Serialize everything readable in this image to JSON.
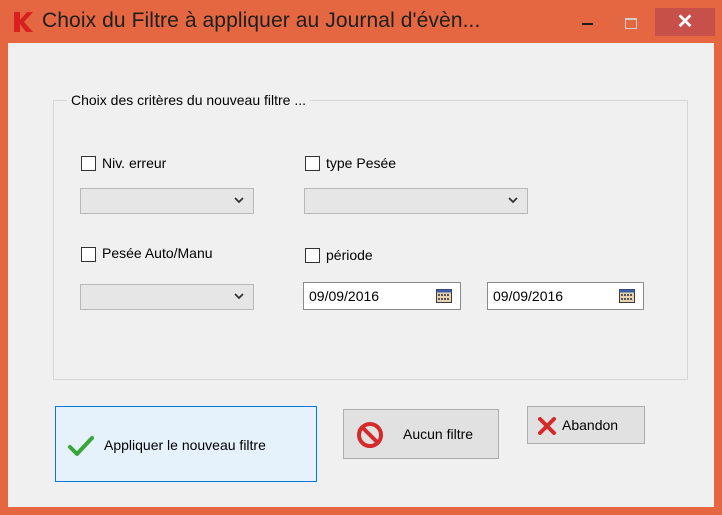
{
  "window": {
    "title": "Choix du Filtre à appliquer au Journal d'évèn...",
    "close_label": "✕",
    "titlebar_color": "#e46742"
  },
  "group": {
    "label": "Choix des critères du nouveau filtre ..."
  },
  "filters": {
    "niv_erreur": {
      "label": "Niv. erreur",
      "checked": false,
      "value": ""
    },
    "type_pesee": {
      "label": "type Pesée",
      "checked": false,
      "value": ""
    },
    "pesee_auto_manu": {
      "label": "Pesée Auto/Manu",
      "checked": false,
      "value": ""
    },
    "periode": {
      "label": "période",
      "checked": false,
      "date_from": "09/09/2016",
      "date_to": "09/09/2016"
    }
  },
  "buttons": {
    "apply": "Appliquer le nouveau filtre",
    "none": "Aucun filtre",
    "abandon": "Abandon"
  },
  "icons": {
    "apply": "check-icon",
    "none": "no-entry-icon",
    "abandon": "red-x-icon",
    "calendar": "calendar-icon"
  }
}
